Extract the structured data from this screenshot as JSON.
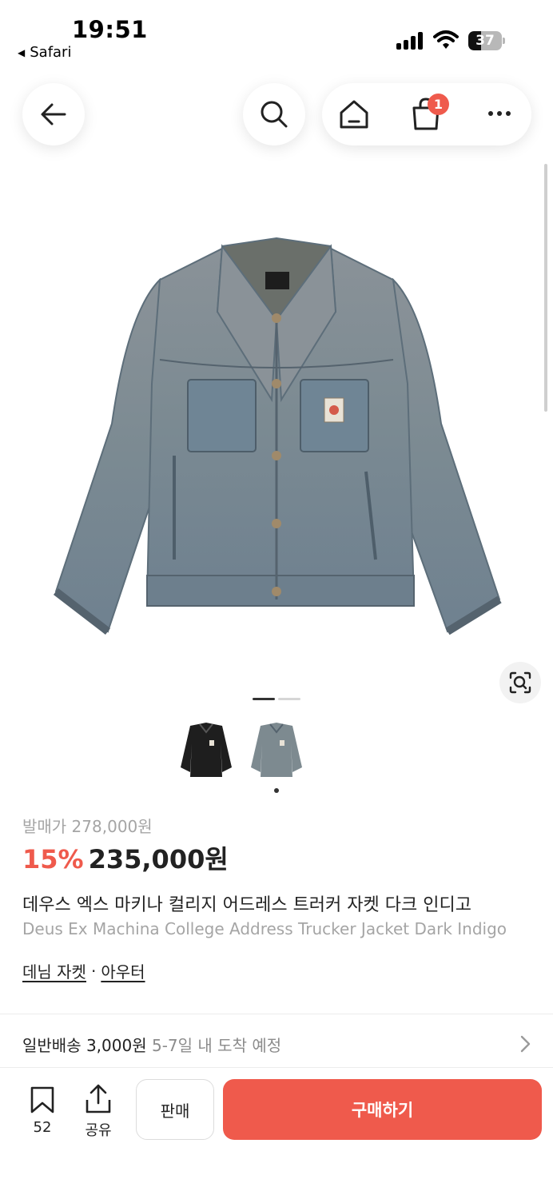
{
  "status_bar": {
    "time": "19:51",
    "back_app": "Safari",
    "battery_percent": "37",
    "battery_level": 0.37
  },
  "nav": {
    "cart_badge": "1",
    "icons": [
      "back-arrow-icon",
      "search-icon",
      "home-icon",
      "shopping-bag-icon",
      "more-icon"
    ]
  },
  "gallery": {
    "current_slide": 1,
    "slide_count": 2,
    "thumbnails": [
      "black denim jacket",
      "washed indigo denim jacket"
    ],
    "selected_thumbnail": 2
  },
  "product": {
    "original_price": "발매가 278,000원",
    "discount": "15%",
    "price": "235,000원",
    "title_ko": "데우스 엑스 마키나 컬리지 어드레스 트러커 자켓 다크 인디고",
    "title_en": "Deus Ex Machina College Address Trucker Jacket Dark Indigo",
    "categories": [
      "데님 자켓",
      "아우터"
    ],
    "category_separator": "·"
  },
  "shipping": {
    "label": "일반배송 3,000원",
    "eta": "5-7일 내 도착 예정"
  },
  "bottom_bar": {
    "bookmark_count": "52",
    "share_label": "공유",
    "sell_label": "판매",
    "buy_label": "구매하기"
  },
  "colors": {
    "accent": "#ef5a4c",
    "muted_text": "#a5a5a5",
    "denim": "#7c8a93"
  }
}
